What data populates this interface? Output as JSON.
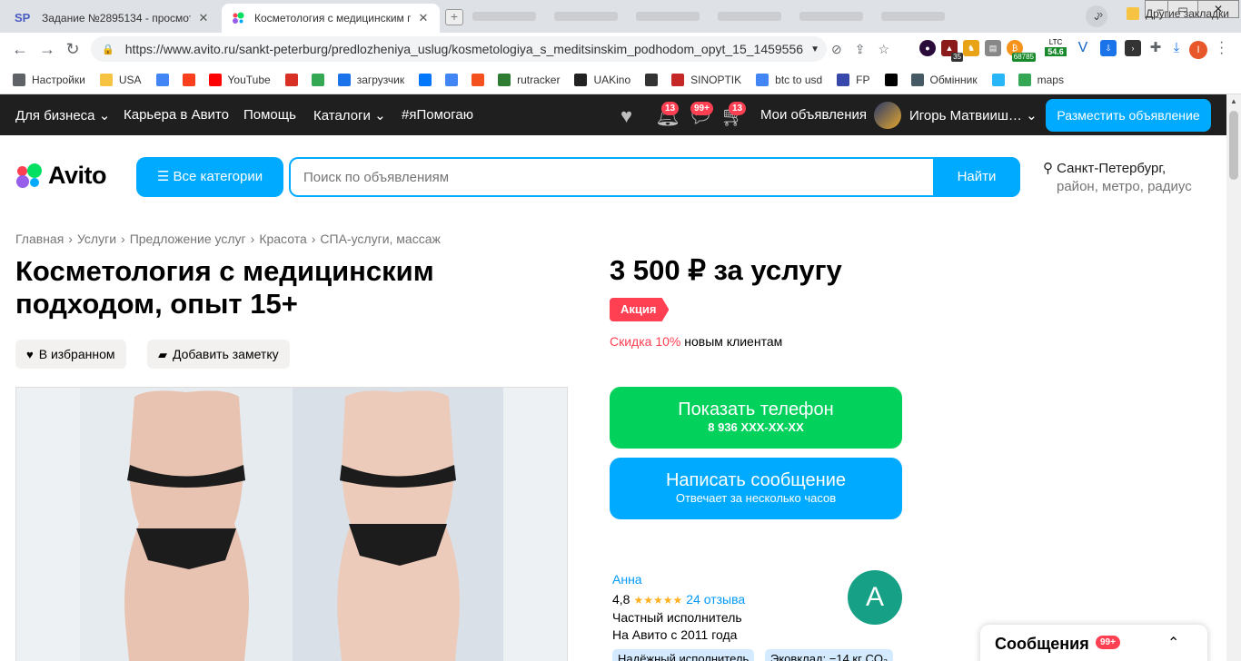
{
  "browser": {
    "tabs": [
      {
        "title": "Задание №2895134 - просмотр з",
        "favicon": "SP"
      },
      {
        "title": "Косметология с медицинским по"
      }
    ],
    "new_tab": "+",
    "url": "https://www.avito.ru/sankt-peterburg/predlozheniya_uslug/kosmetologiya_s_meditsinskim_podhodom_opyt_15_1459556...",
    "ext_badges": {
      "b1": "35",
      "ltc_label": "LTC",
      "ltc_value": "54.6",
      "btc_value": "68785"
    },
    "profile_letter": "I",
    "bookmarks": [
      {
        "label": "Настройки",
        "icon": "gear-icon",
        "color": "#5f6368"
      },
      {
        "label": "USA",
        "icon": "folder-icon",
        "color": "#f6c342"
      },
      {
        "label": "",
        "icon": "google-icon",
        "color": "#4285f4"
      },
      {
        "label": "",
        "icon": "yandex-icon",
        "color": "#fc3f1d"
      },
      {
        "label": "YouTube",
        "icon": "youtube-icon",
        "color": "#ff0000"
      },
      {
        "label": "",
        "icon": "gmail-icon",
        "color": "#d93025"
      },
      {
        "label": "",
        "icon": "drive-icon",
        "color": "#34a853"
      },
      {
        "label": "загрузчик",
        "icon": "loop-icon",
        "color": "#1a73e8"
      },
      {
        "label": "",
        "icon": "vk-icon",
        "color": "#0077ff"
      },
      {
        "label": "",
        "icon": "translate-icon",
        "color": "#4285f4"
      },
      {
        "label": "",
        "icon": "f-icon",
        "color": "#f4511e"
      },
      {
        "label": "rutracker",
        "icon": "rutracker-icon",
        "color": "#2e7d32"
      },
      {
        "label": "UAKino",
        "icon": "uakino-icon",
        "color": "#222222"
      },
      {
        "label": "",
        "icon": "chess-icon",
        "color": "#333333"
      },
      {
        "label": "SINOPTIK",
        "icon": "thermometer-icon",
        "color": "#c62828"
      },
      {
        "label": "btc to usd",
        "icon": "google-icon",
        "color": "#4285f4"
      },
      {
        "label": "FP",
        "icon": "fp-icon",
        "color": "#3949ab"
      },
      {
        "label": "",
        "icon": "bc-icon",
        "color": "#000000"
      },
      {
        "label": "Обмінник",
        "icon": "exchange-icon",
        "color": "#455a64"
      },
      {
        "label": "",
        "icon": "star-icon",
        "color": "#29b6f6"
      },
      {
        "label": "maps",
        "icon": "maps-icon",
        "color": "#34a853"
      }
    ],
    "bookmarks_more": "»",
    "other_bookmarks": "Другие закладки"
  },
  "avito_nav": {
    "business": "Для бизнеса",
    "career": "Карьера в Авито",
    "help": "Помощь",
    "catalogs": "Каталоги",
    "ipomogayu": "#яПомогаю",
    "notifications_count": "13",
    "messages_count": "99+",
    "cart_count": "13",
    "my_ads": "Мои объявления",
    "user_name": "Игорь Матвииш…",
    "post_ad": "Разместить объявление"
  },
  "header": {
    "logo": "Avito",
    "categories": "Все категории",
    "search_placeholder": "Поиск по объявлениям",
    "search_button": "Найти",
    "city": "Санкт-Петербург,",
    "city_sub": "район, метро, радиус"
  },
  "breadcrumb": [
    "Главная",
    "Услуги",
    "Предложение услуг",
    "Красота",
    "СПА-услуги, массаж"
  ],
  "listing": {
    "title": "Косметология с медицинским подходом, опыт 15+",
    "favorite": "В избранном",
    "add_note": "Добавить заметку",
    "price": "3 500 ₽ за услугу",
    "promo": "Акция",
    "discount": "Скидка 10%",
    "discount_note": "новым клиентам",
    "show_phone": "Показать телефон",
    "phone_mask": "8 936 XXX-XX-XX",
    "write_message": "Написать сообщение",
    "reply_time": "Отвечает за несколько часов"
  },
  "seller": {
    "name": "Анна",
    "rating": "4,8",
    "stars": 5,
    "reviews": "24 отзыва",
    "type": "Частный исполнитель",
    "since": "На Авито с 2011 года",
    "avatar_letter": "А",
    "avatar_color": "#16a085",
    "badges": [
      "Надёжный исполнитель",
      "Эковклад: −14 кг CO₂"
    ]
  },
  "messages_panel": {
    "label": "Сообщения",
    "count": "99+"
  },
  "colors": {
    "accent": "#00aaff",
    "green": "#02d15c",
    "promo_red": "#ff4053",
    "nav_bg": "#1f1f1f"
  }
}
